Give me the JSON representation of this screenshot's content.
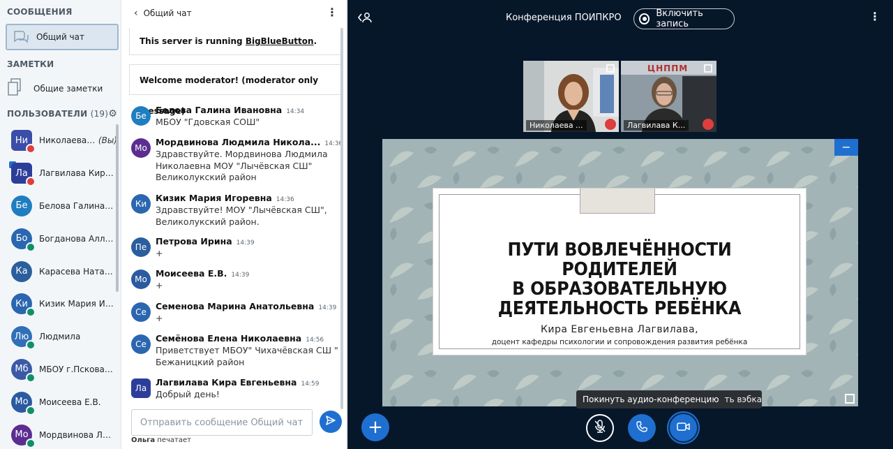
{
  "sidebar": {
    "messages_title": "СООБЩЕНИЯ",
    "public_chat_label": "Общий чат",
    "notes_title": "ЗАМЕТКИ",
    "shared_notes_label": "Общие заметки",
    "users_title": "ПОЛЬЗОВАТЕЛИ",
    "users_count": "(19)",
    "you_label": "(Вы)",
    "users": [
      {
        "initials": "Ни",
        "name": "Николаева Л...",
        "color": "#3a4ea8",
        "status": "muted",
        "mod": true
      },
      {
        "initials": "Ла",
        "name": "Лагвилава Кира Е...",
        "color": "#2c3e9a",
        "status": "muted",
        "mod": true
      },
      {
        "initials": "Бе",
        "name": "Белова Галина И...",
        "color": "#1f7ec0",
        "status": "none",
        "mod": false
      },
      {
        "initials": "Бо",
        "name": "Богданова Алла ...",
        "color": "#2b66b0",
        "status": "listen",
        "mod": false
      },
      {
        "initials": "Ка",
        "name": "Карасева Наталь...",
        "color": "#2b5e9e",
        "status": "none",
        "mod": false
      },
      {
        "initials": "Ки",
        "name": "Кизик Мария Игор...",
        "color": "#2b66b0",
        "status": "listen",
        "mod": false
      },
      {
        "initials": "Лю",
        "name": "Людмила",
        "color": "#3070b8",
        "status": "listen",
        "mod": false
      },
      {
        "initials": "Мб",
        "name": "МБОУ г.Пскова \"С...",
        "color": "#3a5aa8",
        "status": "listen",
        "mod": false
      },
      {
        "initials": "Мо",
        "name": "Моисеева Е.В.",
        "color": "#2b5aa0",
        "status": "listen",
        "mod": false
      },
      {
        "initials": "Мо",
        "name": "Мордвинова Люд...",
        "color": "#5c2d91",
        "status": "listen",
        "mod": false
      }
    ]
  },
  "chat": {
    "title": "Общий чат",
    "system_msg_prefix": "This server is running ",
    "system_msg_link": "BigBlueButton",
    "system_msg_suffix": ".",
    "welcome_msg": "Welcome moderator! (moderator only message)",
    "messages": [
      {
        "initials": "Бе",
        "color": "#1f7ec0",
        "name": "Белова Галина Ивановна",
        "time": "14:34",
        "text": "МБОУ \"Гдовская СОШ\""
      },
      {
        "initials": "Мо",
        "color": "#5c2d91",
        "name": "Мордвинова Людмила Никола...",
        "time": "14:36",
        "text": "Здравствуйте. Мордвинова Людмила Николаевна МОУ \"Лычёвская СШ\" Великолукский район"
      },
      {
        "initials": "Ки",
        "color": "#2b66b0",
        "name": "Кизик Мария Игоревна",
        "time": "14:36",
        "text": "Здравствуйте! МОУ \"Лычёвская СШ\", Великолукский район."
      },
      {
        "initials": "Пе",
        "color": "#2b5e9e",
        "name": "Петрова Ирина",
        "time": "14:39",
        "text": "+"
      },
      {
        "initials": "Мо",
        "color": "#2b5aa0",
        "name": "Моисеева Е.В.",
        "time": "14:39",
        "text": "+"
      },
      {
        "initials": "Се",
        "color": "#2b66b0",
        "name": "Семенова Марина Анатольевна",
        "time": "14:39",
        "text": "+"
      },
      {
        "initials": "Се",
        "color": "#2b66b0",
        "name": "Семёнова Елена Николаевна",
        "time": "14:56",
        "text": "Приветствует МБОУ\" Чихачёвская СШ \" Бежаницкий район"
      },
      {
        "initials": "Ла",
        "color": "#2c3e9a",
        "name": "Лагвилава Кира Евгеньевна",
        "time": "14:59",
        "text": "Добрый день!"
      }
    ],
    "input_placeholder": "Отправить сообщение Общий чат",
    "typing_user": "Ольга",
    "typing_text": " печатает"
  },
  "main": {
    "conference_title": "Конференция ПОИПКРО",
    "record_label": "Включить запись",
    "cameras": [
      {
        "name": "Николаева ...",
        "bg": "#c8cdd0"
      },
      {
        "name": "Лагвилава К...",
        "bg": "#8e9aa4"
      }
    ],
    "slide": {
      "title_lines": [
        "ПУТИ ВОВЛЕЧЁННОСТИ РОДИТЕЛЕЙ",
        "В ОБРАЗОВАТЕЛЬНУЮ",
        "ДЕЯТЕЛЬНОСТЬ РЕБЁНКА"
      ],
      "author": "Кира Евгеньевна Лагвилава,",
      "position": "доцент кафедры психологии и сопровождения развития ребёнка"
    },
    "tooltip_text": "Покинуть аудио-конференцию",
    "tooltip_text_2": "ть вэбкамеру",
    "camera_badge_text": "ЦНППМ"
  },
  "colors": {
    "accent": "#1f6fd0",
    "main_bg": "#06172a",
    "muted": "#de3e3e",
    "listen": "#0f8f6a"
  }
}
